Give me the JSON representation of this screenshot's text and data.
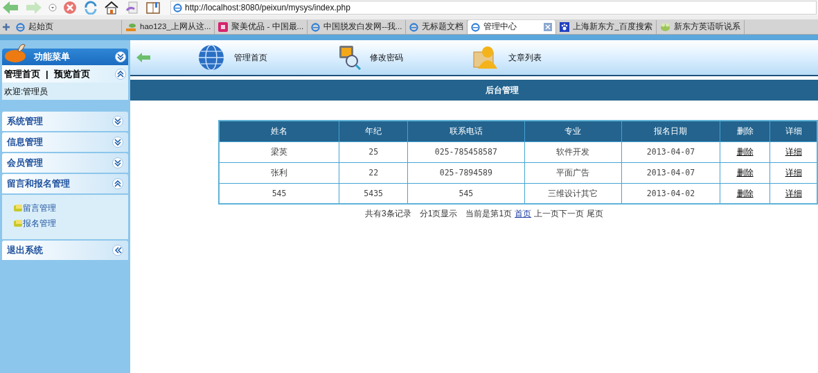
{
  "browser": {
    "address": "http://localhost:8080/peixun/mysys/index.php",
    "tabs": [
      {
        "label": "起始页",
        "kind": "ie",
        "selected": false
      },
      {
        "label": "hao123_上网从这...",
        "kind": "hao",
        "selected": false
      },
      {
        "label": "聚美优品 - 中国最...",
        "kind": "mei",
        "selected": false
      },
      {
        "label": "中国脱发白发网--我...",
        "kind": "ie",
        "selected": false
      },
      {
        "label": "无标题文档",
        "kind": "ie",
        "selected": false
      },
      {
        "label": "管理中心",
        "kind": "ie",
        "selected": true
      },
      {
        "label": "上海新东方_百度搜索",
        "kind": "paw",
        "selected": false
      },
      {
        "label": "新东方英语听说系",
        "kind": "frog",
        "selected": false
      }
    ]
  },
  "sidebar": {
    "title": "功能菜单",
    "links": [
      "管理首页",
      "|",
      "预览首页"
    ],
    "welcome": "欢迎:管理员",
    "sections": [
      {
        "label": "系统管理",
        "kind": "menu",
        "expanded": false
      },
      {
        "label": "信息管理",
        "kind": "menu",
        "expanded": false
      },
      {
        "label": "会员管理",
        "kind": "menu",
        "expanded": false
      },
      {
        "label": "留言和报名管理",
        "kind": "menu",
        "expanded": true,
        "children": [
          "留言管理",
          "报名管理"
        ]
      },
      {
        "label": "退出系统",
        "kind": "exit"
      }
    ]
  },
  "nav": {
    "items": [
      {
        "label": "管理首页",
        "kind": "globe"
      },
      {
        "label": "修改密码",
        "kind": "monitor"
      },
      {
        "label": "文章列表",
        "kind": "user"
      }
    ]
  },
  "panel_title": "后台管理",
  "table": {
    "columns": [
      "姓名",
      "年纪",
      "联系电话",
      "专业",
      "报名日期",
      "删除",
      "详细"
    ],
    "rows": [
      [
        "梁英",
        "25",
        "025-785458587",
        "软件开发",
        "2013-04-07",
        "删除",
        "详细"
      ],
      [
        "张利",
        "22",
        "025-7894589",
        "平面广告",
        "2013-04-07",
        "删除",
        "详细"
      ],
      [
        "545",
        "5435",
        "545",
        "三维设计其它",
        "2013-04-02",
        "删除",
        "详细"
      ]
    ]
  },
  "pagination": {
    "summary": [
      "共有3条记录",
      "分1页显示",
      "当前是第1页"
    ],
    "first": "首页",
    "prev_next": "上一页下一页",
    "last": "尾页"
  }
}
